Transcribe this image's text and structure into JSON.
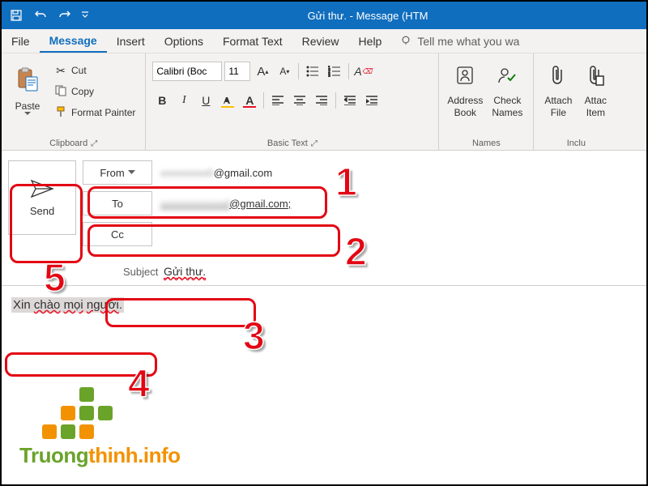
{
  "titlebar": {
    "title": "Gửi thư.  -  Message (HTM"
  },
  "tabs": {
    "file": "File",
    "message": "Message",
    "insert": "Insert",
    "options": "Options",
    "format": "Format Text",
    "review": "Review",
    "help": "Help",
    "tellme": "Tell me what you wa"
  },
  "ribbon": {
    "clipboard": {
      "paste": "Paste",
      "cut": "Cut",
      "copy": "Copy",
      "painter": "Format Painter",
      "label": "Clipboard"
    },
    "font": {
      "name": "Calibri (Boc",
      "size": "11",
      "label": "Basic Text"
    },
    "names": {
      "address": "Address Book",
      "check": "Check Names",
      "label": "Names"
    },
    "include": {
      "attachfile": "Attach File",
      "attachitem": "Attac Item",
      "label": "Inclu"
    }
  },
  "compose": {
    "send": "Send",
    "from_label": "From",
    "from_value": "@gmail.com",
    "to_label": "To",
    "to_value": "@gmail.com;",
    "cc_label": "Cc",
    "subject_label": "Subject",
    "subject_value": "Gửi thư."
  },
  "body": {
    "text": "Xin chào mọi người. "
  },
  "annotations": {
    "n1": "1",
    "n2": "2",
    "n3": "3",
    "n4": "4",
    "n5": "5"
  },
  "watermark": {
    "t1": "Truong",
    "t2": "thinh.info"
  }
}
